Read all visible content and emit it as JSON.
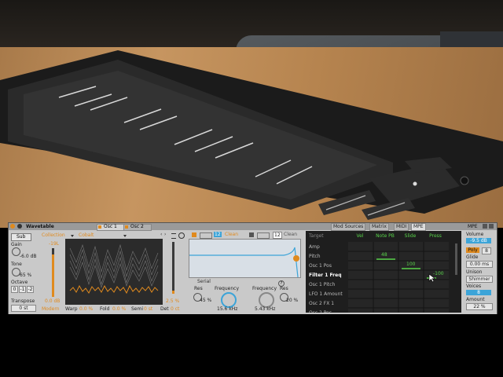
{
  "device": {
    "title": "Wavetable",
    "preset": "MPE"
  },
  "osc_tabs": [
    "Osc 1",
    "Osc 2"
  ],
  "osc": {
    "sub_label": "Sub",
    "gain_label": "Gain",
    "gain_value": "-6.0 dB",
    "tone_label": "Tone",
    "tone_value": "65 %",
    "octave_label": "Octave",
    "octave_options": [
      "0",
      "-1",
      "-2"
    ],
    "transpose_label": "Transpose",
    "transpose_value": "0 st",
    "collection_label": "Collection",
    "wavetable_name": "Cobalt",
    "level_value": "-19L",
    "db_value": "0.0 dB",
    "mode_label": "Modern",
    "warp_label": "Warp",
    "warp_value": "0.0 %",
    "fold_label": "Fold",
    "fold_value": "0.0 %",
    "semi_label": "Semi",
    "semi_value": "0 st",
    "det_label": "Det",
    "det_value": "0 ct",
    "pos_value": "2.5 %"
  },
  "filters": {
    "filter1_num": "12",
    "filter1_type": "Clean",
    "filter2_num": "12",
    "filter2_type": "Clean",
    "routing": "Serial",
    "res1_label": "Res",
    "res1_value": "45 %",
    "freq1_label": "Frequency",
    "freq1_value": "15.6 kHz",
    "freq2_label": "Frequency",
    "freq2_value": "5.43 kHz",
    "res2_label": "Res",
    "res2_value": "20 %"
  },
  "matrix_tabs": [
    "Mod Sources",
    "Matrix",
    "MIDI",
    "MPE"
  ],
  "mpe": {
    "target_header": "Target",
    "columns": [
      "Vel",
      "Note PB",
      "Slide",
      "Press"
    ],
    "rows": [
      "Amp",
      "Pitch",
      "Osc 1 Pos",
      "Filter 1 Freq",
      "Osc 1 Pitch",
      "LFO 1 Amount",
      "Osc 2 FX 1",
      "Osc 2 Pos"
    ],
    "values": {
      "pitch_notepb": "48",
      "osc1pos_slide": "100",
      "filter1freq_press": "-100"
    }
  },
  "global": {
    "volume_label": "Volume",
    "volume_value": "-9.5 dB",
    "poly_label": "Poly",
    "poly_value": "8",
    "glide_label": "Glide",
    "glide_value": "0.00 ms",
    "unison_label": "Unison",
    "unison_value": "Shimmer",
    "voices_label": "Voices",
    "voices_value": "8",
    "amount_label": "Amount",
    "amount_value": "22 %"
  },
  "colors": {
    "accent_orange": "#e08a1e",
    "mpe_green": "#58d24a",
    "filter_blue": "#3ca4d8",
    "panel_bg": "#c9c9c9"
  }
}
